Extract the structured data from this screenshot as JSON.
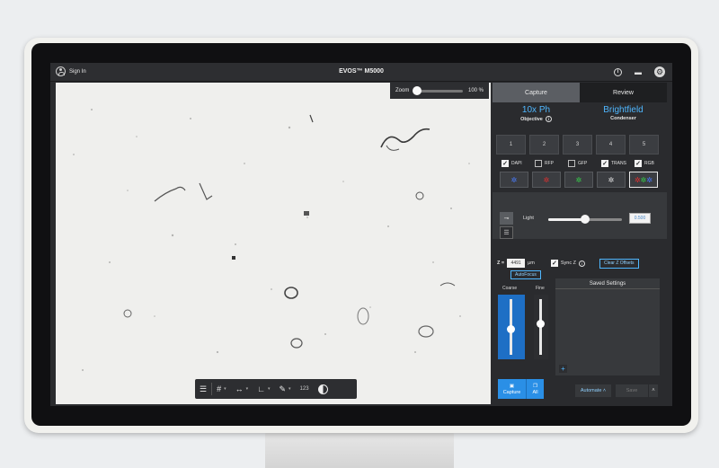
{
  "window": {
    "title": "EVOS™ M5000",
    "sign_in": "Sign In",
    "icons": [
      "user-icon",
      "info-icon",
      "menu-icon",
      "gear-icon"
    ]
  },
  "viewer": {
    "zoom_label": "Zoom",
    "zoom_value": "100 %",
    "zoom_level": 0.0,
    "toolbar": {
      "icons": [
        "adjust-sliders-icon",
        "grid-icon",
        "measure-icon",
        "chart-icon",
        "annotate-icon",
        "contrast-icon"
      ],
      "count": "123"
    }
  },
  "panel": {
    "tabs": [
      {
        "label": "Capture",
        "active": true
      },
      {
        "label": "Review",
        "active": false
      }
    ],
    "objective": {
      "value": "10x Ph",
      "label": "Objective"
    },
    "condenser": {
      "value": "Brightfield",
      "label": "Condenser"
    },
    "cubes": [
      "1",
      "2",
      "3",
      "4",
      "5"
    ],
    "channels": [
      {
        "label": "DAPI",
        "checked": true,
        "color": "#4a7dff"
      },
      {
        "label": "RFP",
        "checked": false,
        "color": "#e03030"
      },
      {
        "label": "GFP",
        "checked": false,
        "color": "#36d24a"
      },
      {
        "label": "TRANS",
        "checked": true,
        "color": "#e6e6e6"
      },
      {
        "label": "RGB",
        "checked": true,
        "color": "#4a7dff"
      }
    ],
    "light": {
      "label": "Light",
      "value": "0.500",
      "level": 0.5
    },
    "z": {
      "label": "Z =",
      "value": "4491",
      "unit": "μm",
      "sync_label": "Sync Z",
      "clear_label": "Clear Z Offsets"
    },
    "autofocus": "AutoFocus",
    "coarse": {
      "label": "Coarse",
      "level": 0.5
    },
    "fine": {
      "label": "Fine",
      "level": 0.6
    },
    "saved_settings": "Saved Settings",
    "capture": "Capture",
    "all": "All",
    "automate": "Automate ˄",
    "save": "Save",
    "accent_color": "#4fb7ff"
  }
}
